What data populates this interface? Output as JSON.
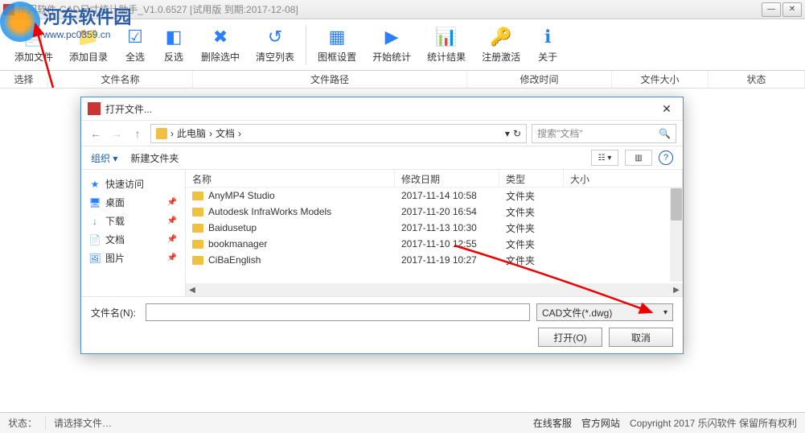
{
  "window": {
    "title": "乐闪软件-CAD尺寸统计助手_V1.0.6527 [试用版 到期:2017-12-08]"
  },
  "watermark": {
    "main": "河东软件园",
    "sub": "www.pc0359.cn"
  },
  "toolbar": [
    {
      "label": "添加文件",
      "icon": "add-file"
    },
    {
      "label": "添加目录",
      "icon": "add-folder"
    },
    {
      "label": "全选",
      "icon": "select-all"
    },
    {
      "label": "反选",
      "icon": "invert"
    },
    {
      "label": "删除选中",
      "icon": "delete"
    },
    {
      "label": "清空列表",
      "icon": "clear"
    },
    {
      "label": "图框设置",
      "icon": "frame"
    },
    {
      "label": "开始统计",
      "icon": "start"
    },
    {
      "label": "统计结果",
      "icon": "result"
    },
    {
      "label": "注册激活",
      "icon": "register"
    },
    {
      "label": "关于",
      "icon": "about"
    }
  ],
  "toolbar_separators_after": [
    5
  ],
  "table_headers": {
    "select": "选择",
    "name": "文件名称",
    "path": "文件路径",
    "mtime": "修改时间",
    "size": "文件大小",
    "state": "状态"
  },
  "dialog": {
    "title": "打开文件...",
    "breadcrumb": [
      "此电脑",
      "文档"
    ],
    "refresh_label": "↻",
    "search_placeholder": "搜索\"文档\"",
    "organize": "组织 ▾",
    "new_folder": "新建文件夹",
    "sidebar": [
      {
        "label": "快速访问",
        "icon": "★",
        "color": "#2a7fff",
        "head": true
      },
      {
        "label": "桌面",
        "icon": "🖥",
        "color": "#2a7fff",
        "pin": true
      },
      {
        "label": "下载",
        "icon": "↓",
        "color": "#2a7fff",
        "pin": true
      },
      {
        "label": "文档",
        "icon": "📄",
        "color": "#2a7fff",
        "pin": true
      },
      {
        "label": "图片",
        "icon": "🖼",
        "color": "#2a7fff",
        "pin": true
      }
    ],
    "file_headers": {
      "name": "名称",
      "date": "修改日期",
      "type": "类型",
      "size": "大小"
    },
    "files": [
      {
        "name": "AnyMP4 Studio",
        "date": "2017-11-14 10:58",
        "type": "文件夹"
      },
      {
        "name": "Autodesk InfraWorks Models",
        "date": "2017-11-20 16:54",
        "type": "文件夹"
      },
      {
        "name": "Baidusetup",
        "date": "2017-11-13 10:30",
        "type": "文件夹"
      },
      {
        "name": "bookmanager",
        "date": "2017-11-10 12:55",
        "type": "文件夹"
      },
      {
        "name": "CiBaEnglish",
        "date": "2017-11-19 10:27",
        "type": "文件夹"
      }
    ],
    "filename_label": "文件名(N):",
    "filename_value": "",
    "filetype": "CAD文件(*.dwg)",
    "open_btn": "打开(O)",
    "cancel_btn": "取消"
  },
  "statusbar": {
    "label": "状态：",
    "text": "请选择文件…",
    "online_service": "在线客服",
    "official_site": "官方网站",
    "copyright": "Copyright 2017 乐闪软件 保留所有权利"
  }
}
